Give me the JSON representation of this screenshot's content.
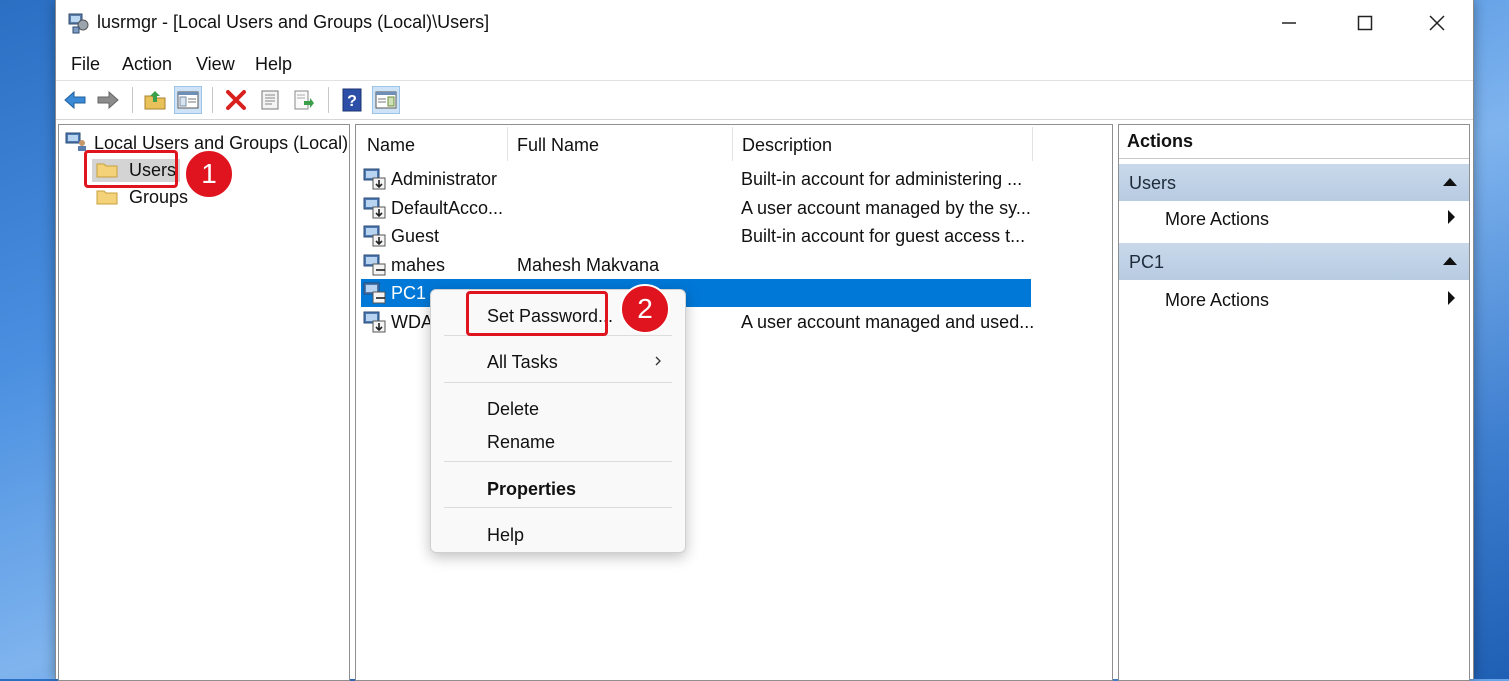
{
  "window": {
    "title": "lusrmgr - [Local Users and Groups (Local)\\Users]"
  },
  "menu": [
    "File",
    "Action",
    "View",
    "Help"
  ],
  "tree": {
    "root": "Local Users and Groups (Local)",
    "items": [
      "Users",
      "Groups"
    ]
  },
  "list": {
    "columns": [
      "Name",
      "Full Name",
      "Description"
    ],
    "rows": [
      {
        "name": "Administrator",
        "full_name": "",
        "description": "Built-in account for administering ..."
      },
      {
        "name": "DefaultAcco...",
        "full_name": "",
        "description": "A user account managed by the sy..."
      },
      {
        "name": "Guest",
        "full_name": "",
        "description": "Built-in account for guest access t..."
      },
      {
        "name": "mahes",
        "full_name": "Mahesh Makvana",
        "description": ""
      },
      {
        "name": "PC1",
        "full_name": "",
        "description": ""
      },
      {
        "name": "WDA",
        "full_name": "",
        "description": "A user account managed and used..."
      }
    ]
  },
  "actions": {
    "header": "Actions",
    "sections": [
      {
        "title": "Users",
        "item": "More Actions"
      },
      {
        "title": "PC1",
        "item": "More Actions"
      }
    ]
  },
  "context_menu": {
    "set_password": "Set Password...",
    "all_tasks": "All Tasks",
    "delete": "Delete",
    "rename": "Rename",
    "properties": "Properties",
    "help": "Help"
  },
  "annotations": {
    "step1": "1",
    "step2": "2"
  },
  "colors": {
    "selection": "#0078d7",
    "annotation_red": "#e0141e",
    "actions_section": "#c9d9ea"
  }
}
